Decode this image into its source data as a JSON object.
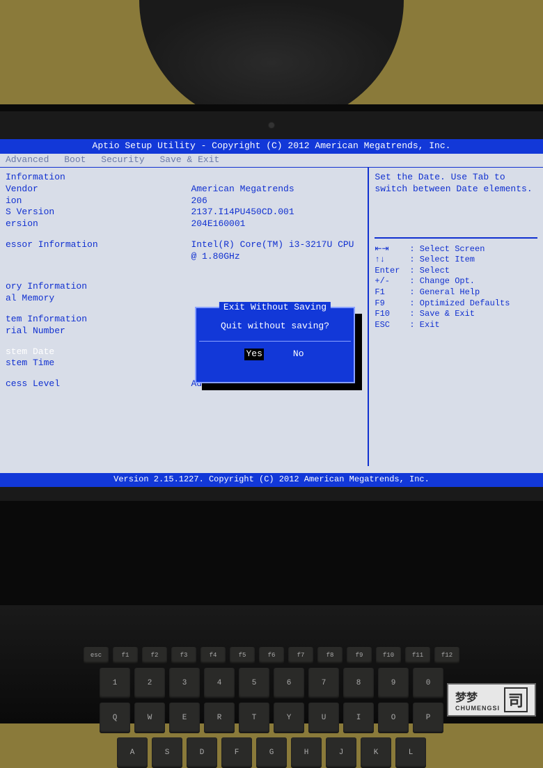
{
  "header": {
    "title": "Aptio Setup Utility - Copyright (C) 2012 American Megatrends, Inc."
  },
  "menu": {
    "items": [
      "Advanced",
      "Boot",
      "Security",
      "Save & Exit"
    ]
  },
  "main": {
    "sections": [
      {
        "label": "Information",
        "value": ""
      },
      {
        "label": "Vendor",
        "value": "American Megatrends"
      },
      {
        "label": "ion",
        "value": "206"
      },
      {
        "label": "S Version",
        "value": "2137.I14PU450CD.001"
      },
      {
        "label": "ersion",
        "value": "204E160001"
      }
    ],
    "processor_header": "essor Information",
    "processor_value": "Intel(R) Core(TM) i3-3217U CPU @ 1.80GHz",
    "memory_header": "ory Information",
    "memory_label": "al Memory",
    "system_header": "tem Information",
    "serial_label": "rial Number",
    "date_label": "stem Date",
    "time_label": "stem Time",
    "access_label": "cess Level",
    "access_value": "Administrator"
  },
  "help": {
    "text1": "Set the Date. Use Tab to",
    "text2": "switch between Date elements.",
    "keys": [
      {
        "key": "⇤⇥",
        "desc": ": Select Screen"
      },
      {
        "key": "↑↓",
        "desc": ": Select Item"
      },
      {
        "key": "Enter",
        "desc": ": Select"
      },
      {
        "key": "+/-",
        "desc": ": Change Opt."
      },
      {
        "key": "F1",
        "desc": ": General Help"
      },
      {
        "key": "F9",
        "desc": ": Optimized Defaults"
      },
      {
        "key": "F10",
        "desc": ": Save & Exit"
      },
      {
        "key": "ESC",
        "desc": ": Exit"
      }
    ]
  },
  "dialog": {
    "title": "Exit Without Saving",
    "message": "Quit without saving?",
    "yes": "Yes",
    "no": "No"
  },
  "footer": {
    "text": "Version 2.15.1227. Copyright (C) 2012 American Megatrends, Inc."
  },
  "keyboard": {
    "row_fn": [
      "esc",
      "f1",
      "f2",
      "f3",
      "f4",
      "f5",
      "f6",
      "f7",
      "f8",
      "f9",
      "f10",
      "f11",
      "f12"
    ],
    "row_num": [
      "1",
      "2",
      "3",
      "4",
      "5",
      "6",
      "7",
      "8",
      "9",
      "0"
    ],
    "row_qw": [
      "Q",
      "W",
      "E",
      "R",
      "T",
      "Y",
      "U",
      "I",
      "O",
      "P"
    ],
    "row_as": [
      "A",
      "S",
      "D",
      "F",
      "G",
      "H",
      "J",
      "K",
      "L"
    ]
  },
  "watermark": {
    "main": "梦梦",
    "sub": "CHUMENGSI",
    "icon": "司"
  }
}
